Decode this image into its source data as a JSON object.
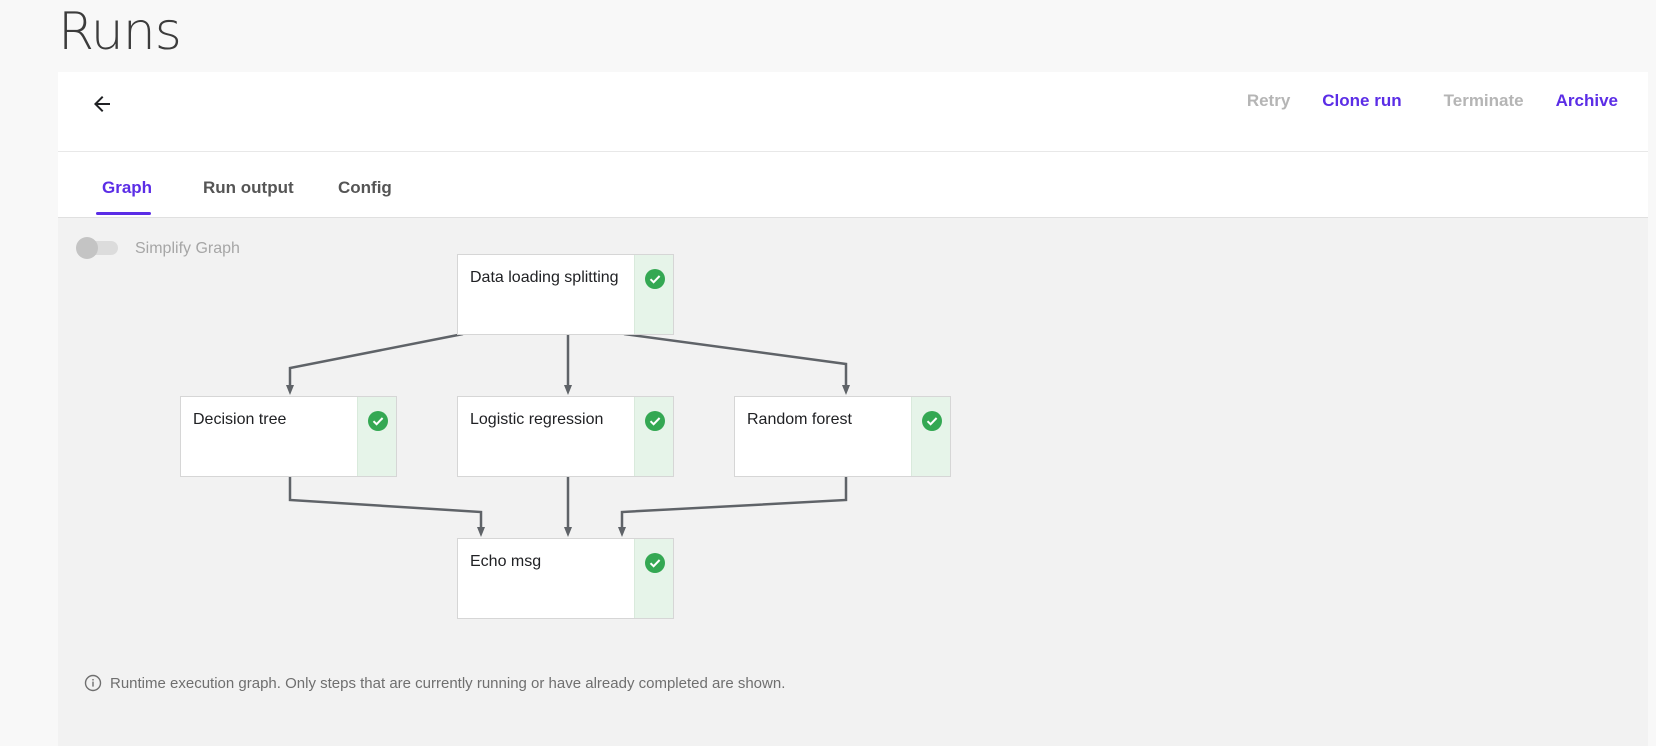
{
  "page": {
    "title": "Runs"
  },
  "toolbar": {
    "back_icon": "arrow-left-icon",
    "actions": [
      {
        "label": "Retry",
        "state": "disabled"
      },
      {
        "label": "Clone run",
        "state": "enabled"
      },
      {
        "label": "Terminate",
        "state": "disabled"
      },
      {
        "label": "Archive",
        "state": "enabled"
      }
    ]
  },
  "tabs": [
    {
      "label": "Graph",
      "active": true
    },
    {
      "label": "Run output",
      "active": false
    },
    {
      "label": "Config",
      "active": false
    }
  ],
  "graph": {
    "simplify_toggle": {
      "label": "Simplify Graph",
      "on": false
    },
    "nodes": [
      {
        "label": "Data loading splitting",
        "status": "succeeded",
        "status_icon": "check-circle-icon"
      },
      {
        "label": "Decision tree",
        "status": "succeeded",
        "status_icon": "check-circle-icon"
      },
      {
        "label": "Logistic regression",
        "status": "succeeded",
        "status_icon": "check-circle-icon"
      },
      {
        "label": "Random forest",
        "status": "succeeded",
        "status_icon": "check-circle-icon"
      },
      {
        "label": "Echo msg",
        "status": "succeeded",
        "status_icon": "check-circle-icon"
      }
    ],
    "info_text": "Runtime execution graph. Only steps that are currently running or have already completed are shown."
  },
  "colors": {
    "accent": "#5b2de6",
    "disabled": "#b5b5b5",
    "success": "#34a853",
    "success_bg": "#e6f4e9",
    "edge": "#5f6368"
  }
}
